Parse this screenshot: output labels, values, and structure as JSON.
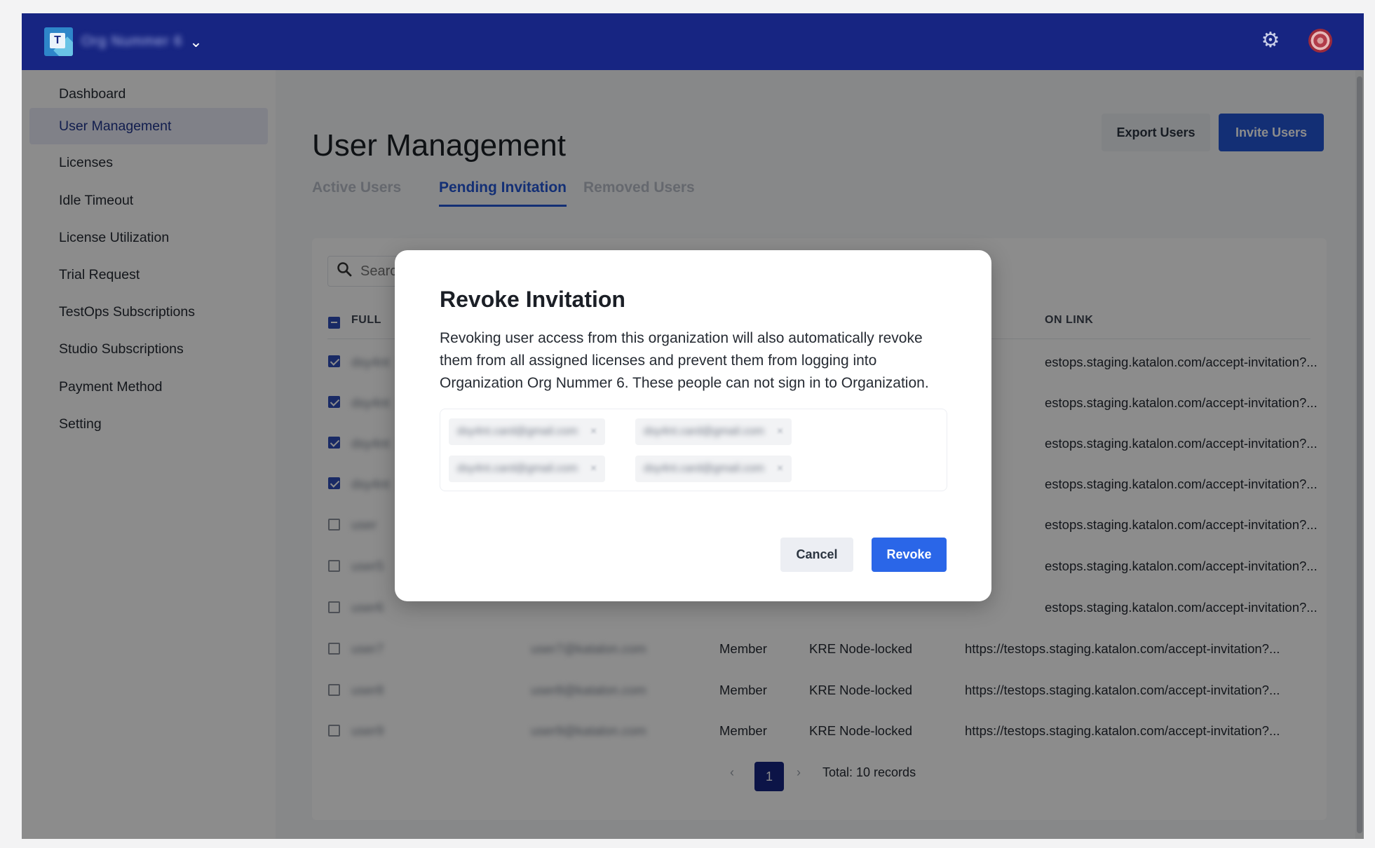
{
  "header": {
    "org_logo_letter": "T",
    "org_name": "Org Nummer 6",
    "chevron": "chevron-down-icon",
    "settings_icon": "gear-icon",
    "avatar_icon": "user-avatar"
  },
  "sidebar": {
    "items": [
      {
        "label": "Dashboard",
        "active": false
      },
      {
        "label": "User Management",
        "active": true
      },
      {
        "label": "Licenses",
        "active": false
      },
      {
        "label": "Idle Timeout",
        "active": false
      },
      {
        "label": "License Utilization",
        "active": false
      },
      {
        "label": "Trial Request",
        "active": false
      },
      {
        "label": "TestOps Subscriptions",
        "active": false
      },
      {
        "label": "Studio Subscriptions",
        "active": false
      },
      {
        "label": "Payment Method",
        "active": false
      },
      {
        "label": "Setting",
        "active": false
      }
    ]
  },
  "main": {
    "title": "User Management",
    "export_label": "Export Users",
    "invite_label": "Invite Users",
    "tabs": [
      {
        "label": "Active Users",
        "active": false
      },
      {
        "label": "Pending Invitation",
        "active": true
      },
      {
        "label": "Removed Users",
        "active": false
      }
    ],
    "search_placeholder": "Search",
    "columns": {
      "full_name": "FULL",
      "invitation_link": "ON LINK"
    },
    "rows": [
      {
        "checked": true,
        "name": "dsy4nt",
        "email": "",
        "role": "",
        "license": "",
        "link": "estops.staging.katalon.com/accept-invitation?..."
      },
      {
        "checked": true,
        "name": "dsy4nt",
        "email": "",
        "role": "",
        "license": "",
        "link": "estops.staging.katalon.com/accept-invitation?..."
      },
      {
        "checked": true,
        "name": "dsy4nt",
        "email": "",
        "role": "",
        "license": "",
        "link": "estops.staging.katalon.com/accept-invitation?..."
      },
      {
        "checked": true,
        "name": "dsy4nt",
        "email": "",
        "role": "",
        "license": "",
        "link": "estops.staging.katalon.com/accept-invitation?..."
      },
      {
        "checked": false,
        "name": "user",
        "email": "",
        "role": "",
        "license": "",
        "link": "estops.staging.katalon.com/accept-invitation?..."
      },
      {
        "checked": false,
        "name": "user5",
        "email": "",
        "role": "",
        "license": "",
        "link": "estops.staging.katalon.com/accept-invitation?..."
      },
      {
        "checked": false,
        "name": "user6",
        "email": "",
        "role": "",
        "license": "",
        "link": "estops.staging.katalon.com/accept-invitation?..."
      },
      {
        "checked": false,
        "name": "user7",
        "email": "user7@katalon.com",
        "role": "Member",
        "license": "KRE Node-locked",
        "link": "https://testops.staging.katalon.com/accept-invitation?..."
      },
      {
        "checked": false,
        "name": "user8",
        "email": "user8@katalon.com",
        "role": "Member",
        "license": "KRE Node-locked",
        "link": "https://testops.staging.katalon.com/accept-invitation?..."
      },
      {
        "checked": false,
        "name": "user9",
        "email": "user9@katalon.com",
        "role": "Member",
        "license": "KRE Node-locked",
        "link": "https://testops.staging.katalon.com/accept-invitation?..."
      }
    ],
    "pagination": {
      "prev": "‹",
      "current_page": "1",
      "next": "›",
      "total": "Total: 10 records"
    }
  },
  "modal": {
    "title": "Revoke Invitation",
    "body": "Revoking user access from this organization will also automatically revoke them from all assigned licenses and prevent them from logging into Organization Org Nummer 6. These people can not sign in to Organization.",
    "chips": [
      {
        "text": "dsy4nt.card@gmail.com",
        "close": "×"
      },
      {
        "text": "dsy4nt.card@gmail.com",
        "close": "×"
      },
      {
        "text": "dsy4nt.card@gmail.com",
        "close": "×"
      },
      {
        "text": "dsy4nt.card@gmail.com",
        "close": "×"
      }
    ],
    "cancel_label": "Cancel",
    "revoke_label": "Revoke"
  },
  "colors": {
    "header_bg": "#172582",
    "primary": "#2457d6",
    "revoke": "#2a66e8"
  }
}
